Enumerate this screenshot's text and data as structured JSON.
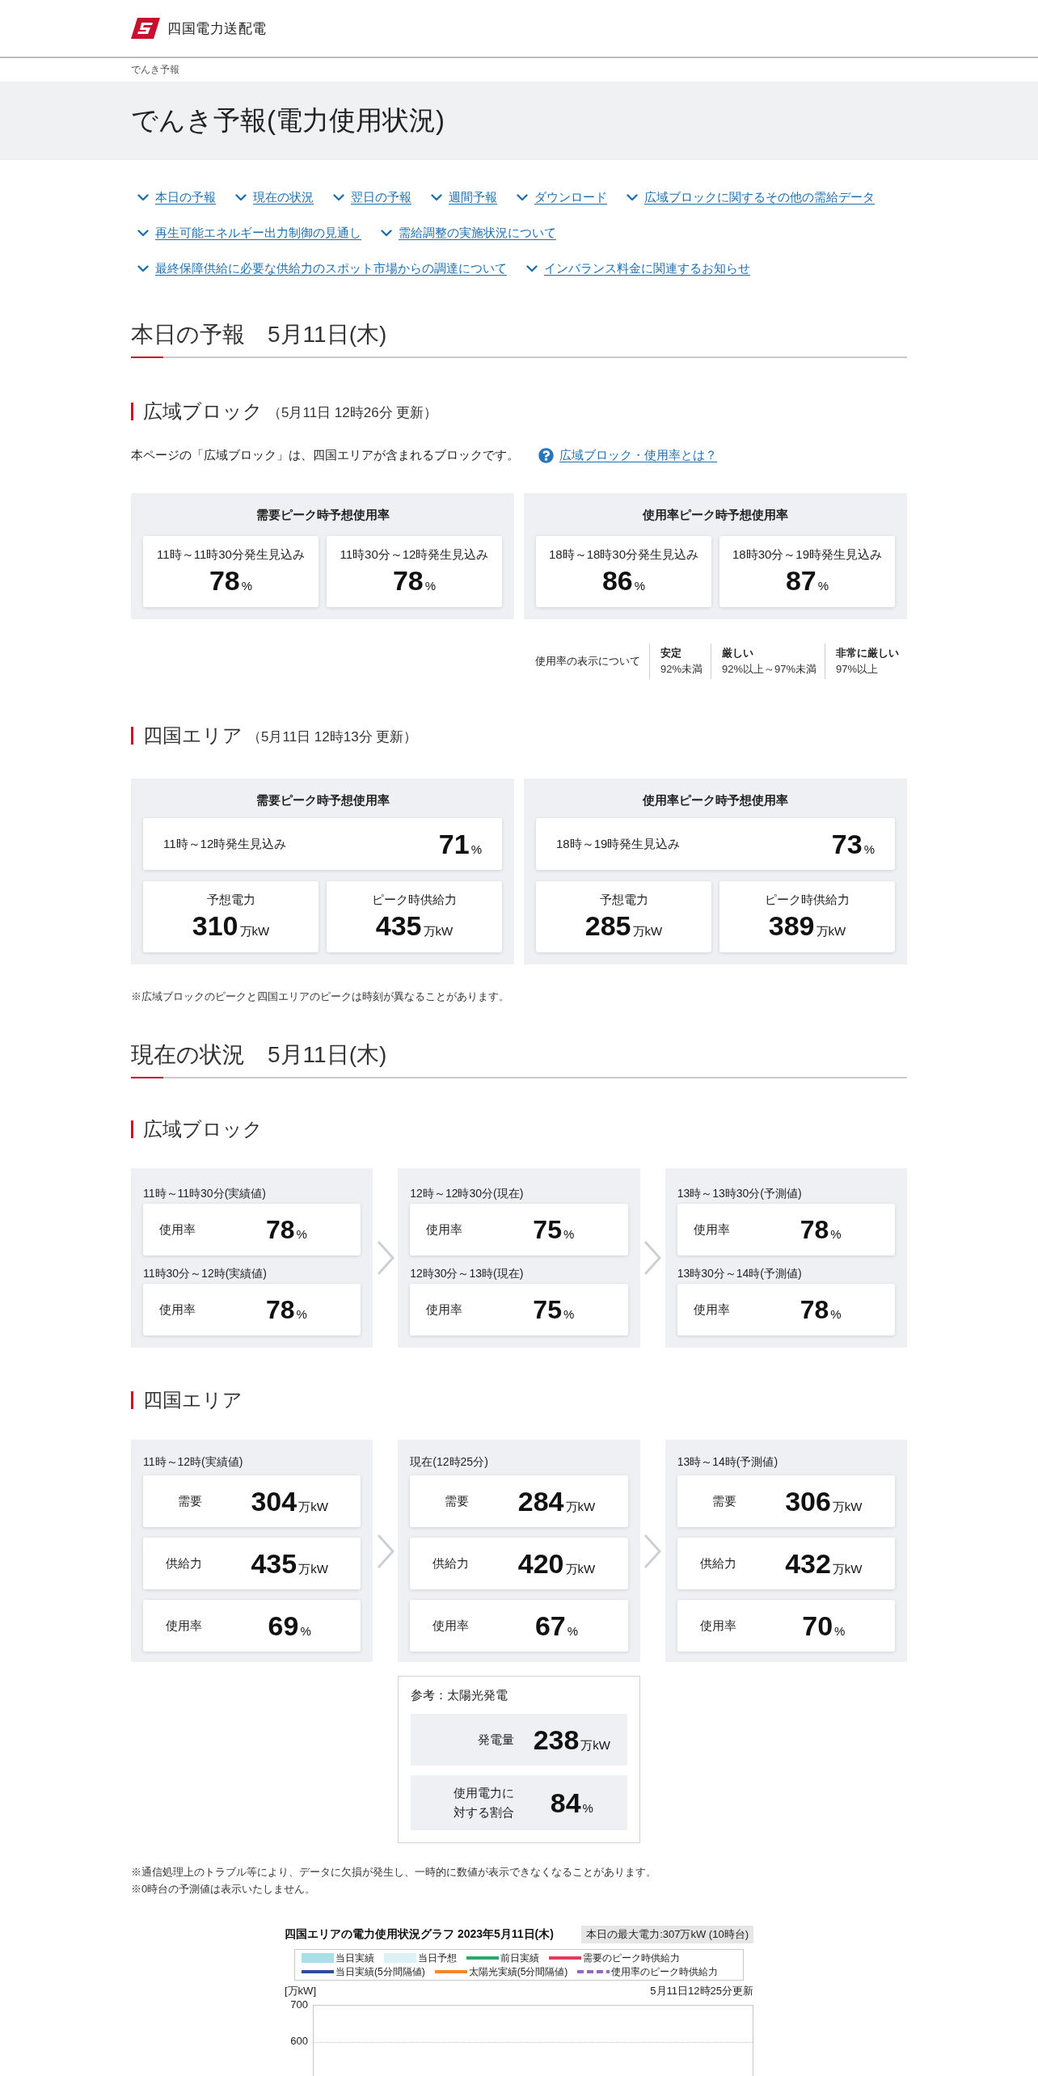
{
  "header": {
    "logo_text": "四国電力送配電"
  },
  "breadcrumb": [
    "でんき予報"
  ],
  "page_title": "でんき予報(電力使用状況)",
  "nav_links": [
    "本日の予報",
    "現在の状況",
    "翌日の予報",
    "週間予報",
    "ダウンロード",
    "広域ブロックに関するその他の需給データ",
    "再生可能エネルギー出力制御の見通し",
    "需給調整の実施状況について",
    "最終保障供給に必要な供給力のスポット市場からの調達について",
    "インバランス料金に関連するお知らせ"
  ],
  "forecast": {
    "heading": "本日の予報　5月11日(木)",
    "block": {
      "title": "広域ブロック",
      "updated": "（5月11日 12時26分 更新）",
      "description": "本ページの「広域ブロック」は、四国エリアが含まれるブロックです。",
      "help_link": "広域ブロック・使用率とは？",
      "panels": [
        {
          "title": "需要ピーク時予想使用率",
          "cards": [
            {
              "label": "11時～11時30分発生見込み",
              "value": "78",
              "unit": "%"
            },
            {
              "label": "11時30分～12時発生見込み",
              "value": "78",
              "unit": "%"
            }
          ]
        },
        {
          "title": "使用率ピーク時予想使用率",
          "cards": [
            {
              "label": "18時～18時30分発生見込み",
              "value": "86",
              "unit": "%"
            },
            {
              "label": "18時30分～19時発生見込み",
              "value": "87",
              "unit": "%"
            }
          ]
        }
      ]
    },
    "rate_legend": {
      "label": "使用率の表示について",
      "levels": [
        {
          "name": "安定",
          "range": "92%未満"
        },
        {
          "name": "厳しい",
          "range": "92%以上～97%未満"
        },
        {
          "name": "非常に厳しい",
          "range": "97%以上"
        }
      ]
    },
    "area": {
      "title": "四国エリア",
      "updated": "（5月11日 12時13分 更新）",
      "panels": [
        {
          "title": "需要ピーク時予想使用率",
          "main": {
            "label": "11時～12時発生見込み",
            "value": "71",
            "unit": "%"
          },
          "cards": [
            {
              "label": "予想電力",
              "value": "310",
              "unit": "万kW"
            },
            {
              "label": "ピーク時供給力",
              "value": "435",
              "unit": "万kW"
            }
          ]
        },
        {
          "title": "使用率ピーク時予想使用率",
          "main": {
            "label": "18時～19時発生見込み",
            "value": "73",
            "unit": "%"
          },
          "cards": [
            {
              "label": "予想電力",
              "value": "285",
              "unit": "万kW"
            },
            {
              "label": "ピーク時供給力",
              "value": "389",
              "unit": "万kW"
            }
          ]
        }
      ]
    },
    "note": "※広域ブロックのピークと四国エリアのピークは時刻が異なることがあります。"
  },
  "current": {
    "heading": "現在の状況　5月11日(木)",
    "block": {
      "title": "広域ブロック",
      "panels": [
        {
          "slots": [
            {
              "period": "11時～11時30分(実績値)",
              "label": "使用率",
              "value": "78",
              "unit": "%"
            },
            {
              "period": "11時30分～12時(実績値)",
              "label": "使用率",
              "value": "78",
              "unit": "%"
            }
          ]
        },
        {
          "slots": [
            {
              "period": "12時～12時30分(現在)",
              "label": "使用率",
              "value": "75",
              "unit": "%"
            },
            {
              "period": "12時30分～13時(現在)",
              "label": "使用率",
              "value": "75",
              "unit": "%"
            }
          ]
        },
        {
          "slots": [
            {
              "period": "13時～13時30分(予測値)",
              "label": "使用率",
              "value": "78",
              "unit": "%"
            },
            {
              "period": "13時30分～14時(予測値)",
              "label": "使用率",
              "value": "78",
              "unit": "%"
            }
          ]
        }
      ]
    },
    "area": {
      "title": "四国エリア",
      "panels": [
        {
          "period": "11時～12時(実績値)",
          "rows": [
            {
              "label": "需要",
              "value": "304",
              "unit": "万kW"
            },
            {
              "label": "供給力",
              "value": "435",
              "unit": "万kW"
            },
            {
              "label": "使用率",
              "value": "69",
              "unit": "%"
            }
          ]
        },
        {
          "period": "現在(12時25分)",
          "rows": [
            {
              "label": "需要",
              "value": "284",
              "unit": "万kW"
            },
            {
              "label": "供給力",
              "value": "420",
              "unit": "万kW"
            },
            {
              "label": "使用率",
              "value": "67",
              "unit": "%"
            }
          ]
        },
        {
          "period": "13時～14時(予測値)",
          "rows": [
            {
              "label": "需要",
              "value": "306",
              "unit": "万kW"
            },
            {
              "label": "供給力",
              "value": "432",
              "unit": "万kW"
            },
            {
              "label": "使用率",
              "value": "70",
              "unit": "%"
            }
          ]
        }
      ]
    },
    "solar": {
      "title": "参考：太陽光発電",
      "rows": [
        {
          "label": "発電量",
          "value": "238",
          "unit": "万kW"
        },
        {
          "label": "使用電力に対する割合",
          "value": "84",
          "unit": "%"
        }
      ]
    },
    "notes": [
      "※通信処理上のトラブル等により、データに欠損が発生し、一時的に数値が表示できなくなることがあります。",
      "※0時台の予測値は表示いたしません。"
    ]
  },
  "graph": {
    "title": "四国エリアの電力使用状況グラフ 2023年5月11日(木)",
    "max_power": "本日の最大電力:307万kW (10時台)",
    "legend_rows": [
      {
        "items": [
          {
            "label": "当日実績",
            "kind": "box",
            "color": "#a9dfe9"
          },
          {
            "label": "当日予想",
            "kind": "box",
            "color": "#dcf1f6"
          },
          {
            "label": "前日実績",
            "kind": "line",
            "color": "#2ea56b"
          },
          {
            "label": "需要のピーク時供給力",
            "kind": "line",
            "color": "#e33b5c"
          }
        ]
      },
      {
        "items": [
          {
            "label": "当日実績(5分間隔値)",
            "kind": "line",
            "color": "#2c4c9c"
          },
          {
            "label": "太陽光実績(5分間隔値)",
            "kind": "line",
            "color": "#f5891f"
          },
          {
            "label": "使用率のピーク時供給力",
            "kind": "dashed",
            "color": "#9566c8"
          }
        ]
      }
    ],
    "y_unit": "[万kW]",
    "updated": "5月11日12時25分更新",
    "y_ticks": [
      "700",
      "600"
    ]
  }
}
